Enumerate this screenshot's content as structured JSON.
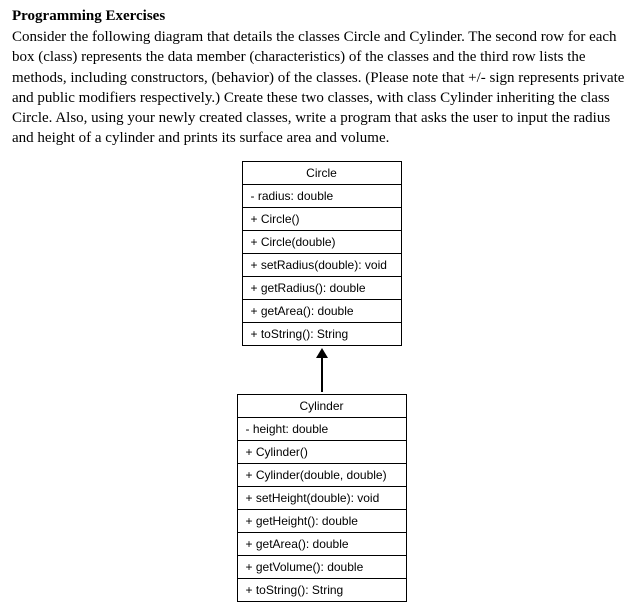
{
  "heading": "Programming Exercises",
  "paragraph": "Consider the following diagram that details the classes Circle and Cylinder. The second row for each box (class) represents the data member (characteristics) of the classes and the third row lists the methods, including constructors, (behavior) of the classes. (Please note that +/- sign represents private and public modifiers respectively.) Create these two classes, with class Cylinder inheriting the class Circle. Also, using your newly created classes, write a program that asks the user to input the radius and height of a cylinder and prints its surface area and volume.",
  "circle": {
    "name": "Circle",
    "attr": "- radius: double",
    "methods": {
      "m0": "+ Circle()",
      "m1": "+ Circle(double)",
      "m2": "+ setRadius(double): void",
      "m3": "+ getRadius(): double",
      "m4": "+ getArea(): double",
      "m5": "+ toString(): String"
    }
  },
  "cylinder": {
    "name": "Cylinder",
    "attr": "- height: double",
    "methods": {
      "m0": "+ Cylinder()",
      "m1": "+ Cylinder(double, double)",
      "m2": "+ setHeight(double): void",
      "m3": "+ getHeight(): double",
      "m4": "+ getArea(): double",
      "m5": "+ getVolume(): double",
      "m6": "+ toString(): String"
    }
  }
}
